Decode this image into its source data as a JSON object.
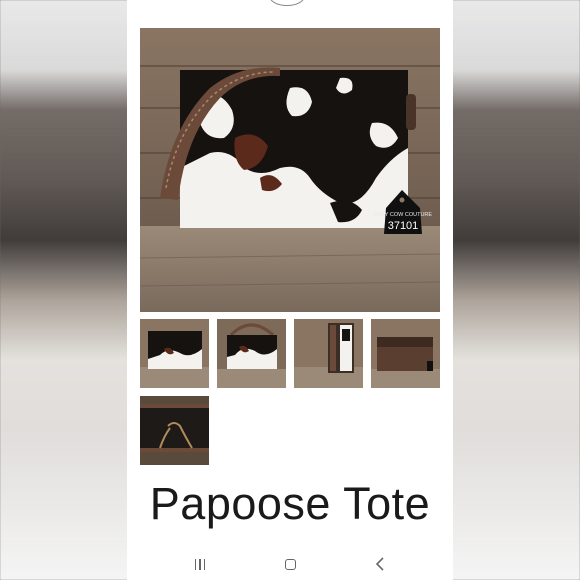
{
  "product": {
    "title": "Papoose Tote",
    "ear_tag": {
      "brand": "HOLY COW COUTURE",
      "number": "37101"
    }
  },
  "gallery": {
    "thumbnails": [
      {
        "label": "front view"
      },
      {
        "label": "front view with strap"
      },
      {
        "label": "side view"
      },
      {
        "label": "back view"
      },
      {
        "label": "bottom detail"
      }
    ]
  },
  "navbar": {
    "icons": [
      "recents-icon",
      "home-icon",
      "back-icon"
    ]
  },
  "colors": {
    "wood_dark": "#5a4a3c",
    "wood_light": "#8b7a68",
    "hide_white": "#f4f2ee",
    "hide_black": "#151210",
    "hide_brown": "#5b2a1a",
    "leather": "#6b4a3a"
  }
}
